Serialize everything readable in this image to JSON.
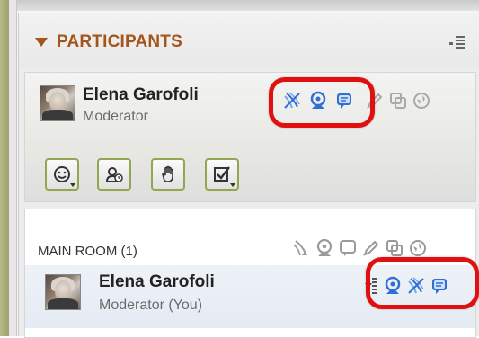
{
  "panel": {
    "title": "PARTICIPANTS"
  },
  "self": {
    "name": "Elena Garofoli",
    "role": "Moderator"
  },
  "room": {
    "title": "MAIN ROOM (1)",
    "user": {
      "name": "Elena Garofoli",
      "role": "Moderator (You)"
    }
  },
  "icons": {
    "self_active": [
      "microphone-off-icon",
      "webcam-icon",
      "chat-icon"
    ],
    "self_inactive": [
      "pencil-icon",
      "windows-icon",
      "globe-icon"
    ],
    "status_buttons": [
      "smiley-status-icon",
      "away-status-icon",
      "raise-hand-icon",
      "checkbox-status-icon"
    ],
    "room_header": [
      "microphone-icon",
      "webcam-icon",
      "chat-icon",
      "pencil-icon",
      "windows-icon",
      "globe-icon"
    ],
    "room_user_active": [
      "webcam-icon",
      "microphone-off-icon",
      "chat-icon"
    ]
  },
  "colors": {
    "title": "#a5551c",
    "highlight": "#e01010",
    "active_icon": "#2f6fd6",
    "status_border": "#8fa84f"
  }
}
